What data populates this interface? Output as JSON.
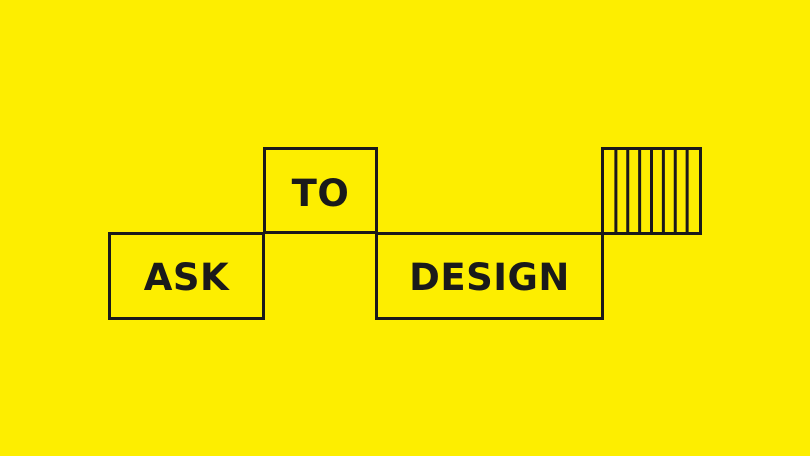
{
  "background_color": "#fdee00",
  "ink_color": "#1a1a1a",
  "logo": {
    "word_1": "ASK",
    "word_2": "TO",
    "word_3": "DESIGN"
  },
  "stripes": {
    "icon": "vertical-stripes-block",
    "count": 8
  }
}
